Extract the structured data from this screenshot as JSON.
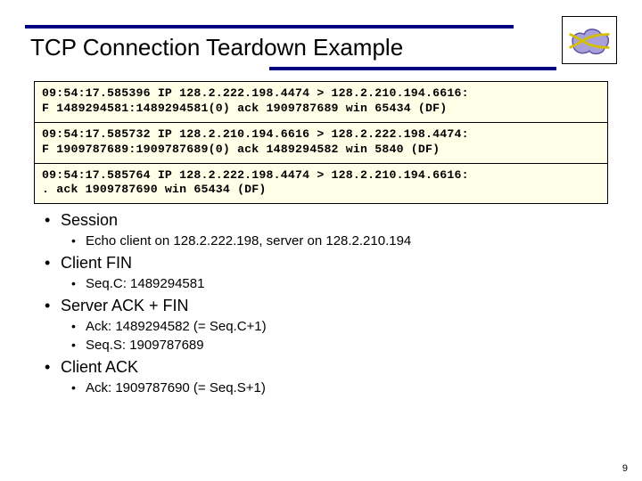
{
  "title": "TCP Connection Teardown Example",
  "packets": [
    {
      "l1": "09:54:17.585396 IP 128.2.222.198.4474 > 128.2.210.194.6616:",
      "l2": "F 1489294581:1489294581(0) ack 1909787689 win 65434 (DF)"
    },
    {
      "l1": "09:54:17.585732 IP 128.2.210.194.6616 > 128.2.222.198.4474:",
      "l2": "F 1909787689:1909787689(0) ack 1489294582 win 5840 (DF)"
    },
    {
      "l1": "09:54:17.585764 IP 128.2.222.198.4474 > 128.2.210.194.6616:",
      "l2": ". ack 1909787690 win 65434 (DF)"
    }
  ],
  "bullets": [
    {
      "text": "Session",
      "sub": [
        "Echo client on 128.2.222.198, server on 128.2.210.194"
      ]
    },
    {
      "text": "Client FIN",
      "sub": [
        "Seq.C: 1489294581"
      ]
    },
    {
      "text": "Server ACK + FIN",
      "sub": [
        "Ack: 1489294582 (= Seq.C+1)",
        "Seq.S: 1909787689"
      ]
    },
    {
      "text": "Client ACK",
      "sub": [
        "Ack: 1909787690 (= Seq.S+1)"
      ]
    }
  ],
  "page_number": "9"
}
